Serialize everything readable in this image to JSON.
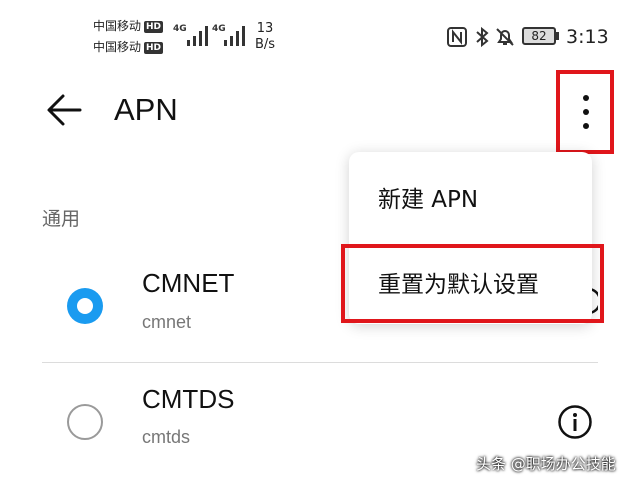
{
  "status_bar": {
    "carrier1": "中国移动",
    "carrier2": "中国移动",
    "hd": "HD",
    "net1": "4G",
    "net2": "4G",
    "speed_value": "13",
    "speed_unit": "B/s",
    "battery": "82",
    "time": "3:13"
  },
  "app_bar": {
    "title": "APN"
  },
  "section": {
    "label": "通用"
  },
  "apn_list": [
    {
      "name": "CMNET",
      "apn": "cmnet",
      "selected": true
    },
    {
      "name": "CMTDS",
      "apn": "cmtds",
      "selected": false
    }
  ],
  "menu": {
    "items": [
      "新建 APN",
      "重置为默认设置"
    ]
  },
  "watermark": "头条 @职场办公技能",
  "colors": {
    "accent": "#1a9bf0",
    "highlight": "#e0161b"
  }
}
